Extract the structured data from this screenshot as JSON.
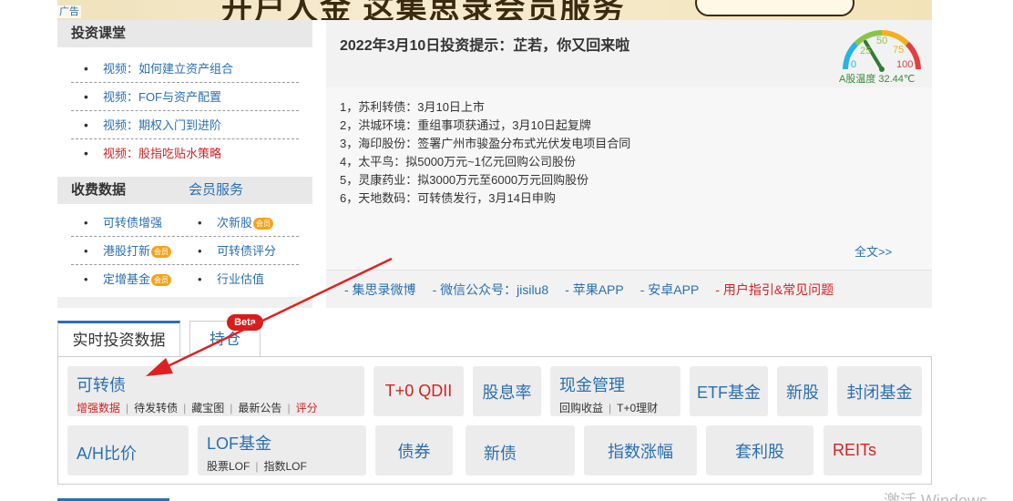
{
  "banner": {
    "ad_label": "广告",
    "text": "开户人金 这集思录会员服务"
  },
  "invest_course": {
    "title": "投资课堂",
    "items": [
      {
        "label": "视频：如何建立资产组合",
        "red": false
      },
      {
        "label": "视频：FOF与资产配置",
        "red": false
      },
      {
        "label": "视频：期权入门到进阶",
        "red": false
      },
      {
        "label": "视频：股指吃贴水策略",
        "red": true
      }
    ]
  },
  "paid_data": {
    "title": "收费数据",
    "member_link": "会员服务",
    "badge": "会员",
    "rows": [
      [
        {
          "label": "可转债增强",
          "badge": false
        },
        {
          "label": "次新股",
          "badge": true
        }
      ],
      [
        {
          "label": "港股打新",
          "badge": true
        },
        {
          "label": "可转债评分",
          "badge": false
        }
      ],
      [
        {
          "label": "定增基金",
          "badge": true
        },
        {
          "label": "行业估值",
          "badge": false
        }
      ]
    ]
  },
  "tips": {
    "title": "2022年3月10日投资提示：芷若，你又回来啦",
    "items": [
      "1，苏利转债：3月10日上市",
      "2，洪城环境：重组事项获通过，3月10日起复牌",
      "3，海印股份：签署广州市骏盈分布式光伏发电项目合同",
      "4，太平鸟：拟5000万元~1亿元回购公司股份",
      "5，灵康药业：拟3000万元至6000万元回购股份",
      "6，天地数码：可转债发行，3月14日申购"
    ],
    "more": "全文>>",
    "links": [
      {
        "label": "- 集思录微博",
        "red": false
      },
      {
        "label": "- 微信公众号：jisilu8",
        "red": false
      },
      {
        "label": "- 苹果APP",
        "red": false
      },
      {
        "label": "- 安卓APP",
        "red": false
      },
      {
        "label": "- 用户指引&常见问题",
        "red": true
      }
    ]
  },
  "gauge": {
    "ticks": [
      "0",
      "25",
      "50",
      "75",
      "100"
    ],
    "label": "A股温度 32.44℃",
    "value": 32.44
  },
  "tabs": {
    "active": "实时投资数据",
    "second": "持仓",
    "beta": "Beta"
  },
  "grid": {
    "convertible": {
      "title": "可转债",
      "subs": [
        "增强数据",
        "待发转债",
        "藏宝图",
        "最新公告",
        "评分"
      ]
    },
    "t0qdii": "T+0 QDII",
    "dividend": "股息率",
    "cash": {
      "title": "现金管理",
      "subs": [
        "回购收益",
        "T+0理财"
      ]
    },
    "etf": "ETF基金",
    "ipo": "新股",
    "closed_fund": "封闭基金",
    "ah": "A/H比价",
    "lof": {
      "title": "LOF基金",
      "subs": [
        "股票LOF",
        "指数LOF"
      ]
    },
    "bond": "债券",
    "new_bond": "新债",
    "index_change": "指数涨幅",
    "arbitrage": "套利股",
    "reits": "REITs"
  },
  "watermark": "激活 Windows",
  "colors": {
    "link": "#2a6fb0",
    "red": "#d82020",
    "badge": "#f3a41c",
    "arrow": "#e02020"
  }
}
